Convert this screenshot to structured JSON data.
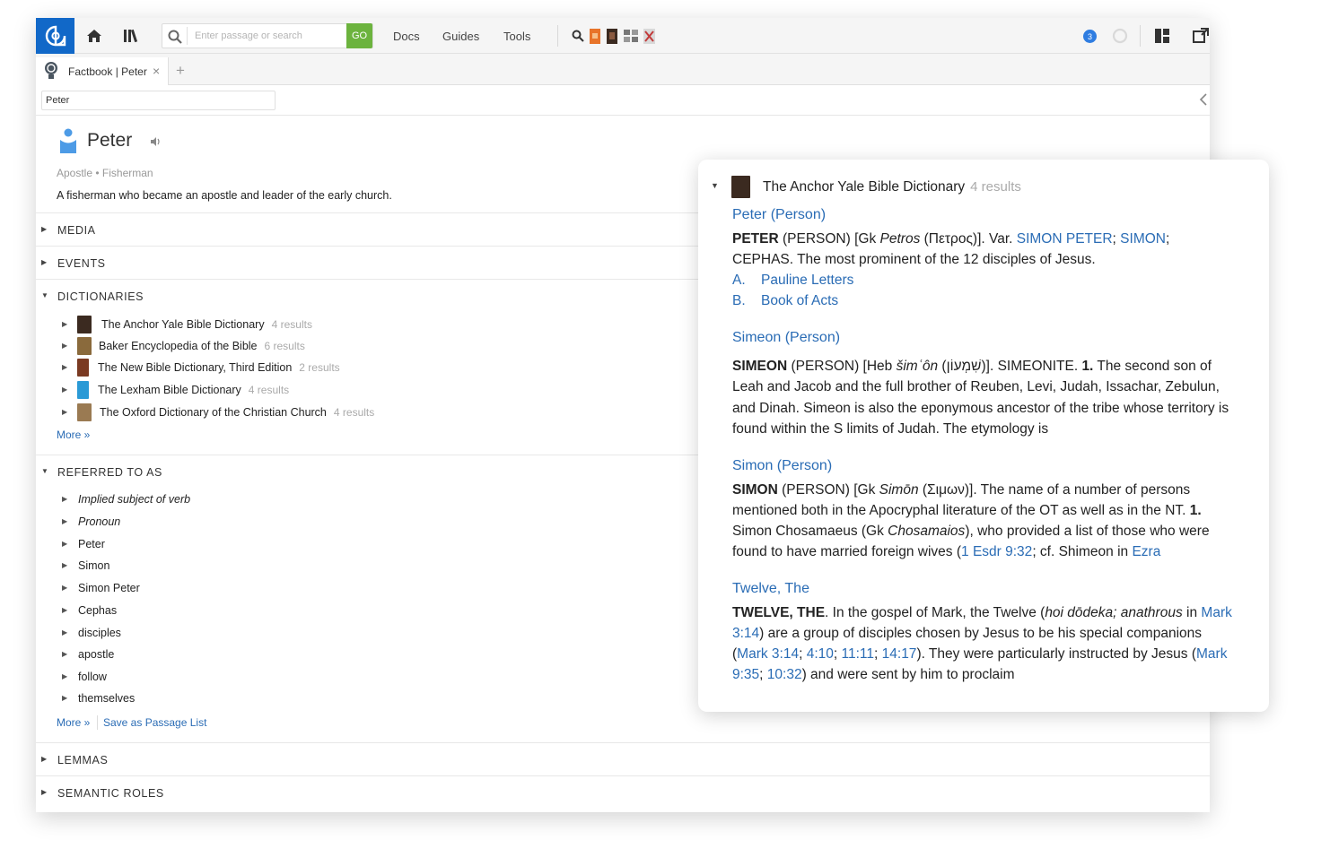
{
  "toolbar": {
    "search_placeholder": "Enter passage or search",
    "go_label": "GO",
    "menus": [
      "Docs",
      "Guides",
      "Tools"
    ],
    "notification_count": "3"
  },
  "tab": {
    "label": "Factbook | Peter",
    "close": "×",
    "add": "+"
  },
  "factbook_search": {
    "value": "Peter"
  },
  "hero": {
    "title": "Peter",
    "subtitle": "Apostle • Fisherman",
    "description": "A fisherman who became an apostle and leader of the early church."
  },
  "sections": {
    "media": "MEDIA",
    "events": "EVENTS",
    "dictionaries": "DICTIONARIES",
    "referred": "REFERRED TO AS",
    "lemmas": "LEMMAS",
    "semantic_roles": "SEMANTIC ROLES"
  },
  "dictionaries": [
    {
      "name": "The Anchor Yale Bible Dictionary",
      "count": "4 results",
      "color": "#3b2a20"
    },
    {
      "name": "Baker Encyclopedia of the Bible",
      "count": "6 results",
      "color": "#8a6a3c"
    },
    {
      "name": "The New Bible Dictionary, Third Edition",
      "count": "2 results",
      "color": "#7a3a22"
    },
    {
      "name": "The Lexham Bible Dictionary",
      "count": "4 results",
      "color": "#2a9ad6"
    },
    {
      "name": "The Oxford Dictionary of the Christian Church",
      "count": "4 results",
      "color": "#9a7a52"
    }
  ],
  "dict_more": "More »",
  "referred": [
    {
      "label": "Implied subject of verb",
      "italic": true
    },
    {
      "label": "Pronoun",
      "italic": true
    },
    {
      "label": "Peter",
      "italic": false
    },
    {
      "label": "Simon",
      "italic": false
    },
    {
      "label": "Simon Peter",
      "italic": false
    },
    {
      "label": "Cephas",
      "italic": false
    },
    {
      "label": "disciples",
      "italic": false
    },
    {
      "label": "apostle",
      "italic": false
    },
    {
      "label": "follow",
      "italic": false
    },
    {
      "label": "themselves",
      "italic": false
    }
  ],
  "referred_more": "More »",
  "save_passage_list": "Save as Passage List",
  "popup": {
    "book_title": "The Anchor Yale Bible Dictionary",
    "book_count": "4 results",
    "e1": {
      "heading": "Peter (Person)",
      "head": "PETER",
      "t1": " (PERSON) [Gk ",
      "t1i": "Petros",
      "t2": " (Πετρος)]. Var. ",
      "l1": "SIMON PETER",
      "t3": "; ",
      "l2": "SIMON",
      "t4": ";",
      "line2": "CEPHAS. The most prominent of the 12 disciples of Jesus.",
      "a_label": "A.",
      "a_link": "Pauline Letters",
      "b_label": "B.",
      "b_link": "Book of Acts"
    },
    "e2": {
      "heading": "Simeon (Person)",
      "head": "SIMEON",
      "t1": " (PERSON) [Heb ",
      "t1i": "šimʿôn",
      "t2": " (שִׁמְעוֹן)]. SIMEONITE. ",
      "num": "1.",
      "t3": " The second son of Leah and Jacob and the full brother of Reuben, Levi, Judah, Issachar, Zebulun, and Dinah. Simeon is also the eponymous ancestor of the tribe whose territory is found within the S limits of Judah. The etymology is"
    },
    "e3": {
      "heading": "Simon (Person)",
      "head": "SIMON",
      "t1": " (PERSON) [Gk ",
      "t1i": "Simōn",
      "t2": " (Σιμων)]. The name of a number of persons mentioned both in the Apocryphal literature of the OT as well as in the NT. ",
      "num": "1.",
      "t3": " Simon Chosamaeus (Gk ",
      "t3i": "Chosamaios",
      "t4": "), who provided a list of those who were found to have married foreign wives (",
      "l1": "1 Esdr 9:32",
      "t5": "; cf. Shimeon in ",
      "l2": "Ezra"
    },
    "e4": {
      "heading": "Twelve, The",
      "head": "TWELVE, THE",
      "t1": ". In the gospel of Mark, the Twelve (",
      "t1i": "hoi dōdeka; anathrous",
      "t2": " in ",
      "l1": "Mark 3:14",
      "t3": ") are a group of disciples chosen by Jesus to be his special companions (",
      "l2": "Mark 3:14",
      "s1": "; ",
      "l3": "4:10",
      "s2": "; ",
      "l4": "11:11",
      "s3": "; ",
      "l5": "14:17",
      "t4": "). They were particularly instructed by Jesus (",
      "l6": "Mark 9:35",
      "s4": "; ",
      "l7": "10:32",
      "t5": ") and were sent by him to proclaim"
    }
  },
  "colors": {
    "accent": "#1168c8",
    "link": "#2a6cb5",
    "go": "#6cb33e"
  }
}
